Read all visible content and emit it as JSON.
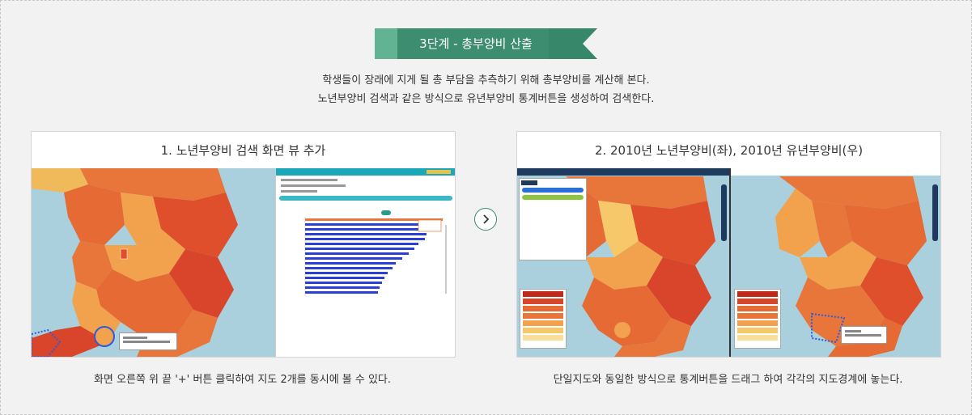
{
  "step": {
    "title": "3단계 - 총부양비 산출",
    "description_lines": [
      "학생들이 장래에 지게 될 총 부담을 추측하기 위해 총부양비를 계산해 본다.",
      "노년부양비 검색과 같은 방식으로 유년부양비 통계버튼을 생성하여 검색한다."
    ]
  },
  "cards": [
    {
      "title": "1. 노년부양비 검색 화면 뷰 추가",
      "caption": "화면 오른쪽 위 끝 '+' 버튼 클릭하여 지도 2개를 동시에 볼 수 있다."
    },
    {
      "title": "2. 2010년 노년부양비(좌), 2010년 유년부양비(우)",
      "caption": "단일지도와 동일한 방식으로 통계버튼을 드래그 하여 각각의 지도경계에 놓는다."
    }
  ],
  "next_button": {
    "icon": "chevron-right-icon"
  },
  "colors": {
    "ribbon": "#3d8e70",
    "ribbon_light": "#62b394",
    "map_water": "#a9d0dc",
    "map_dark": "#d9452a",
    "map_mid": "#e8763a",
    "map_light": "#f2a24c",
    "map_pale": "#f6c86a",
    "bar_blue": "#2a3fd6",
    "panel_teal": "#1aa7b8"
  }
}
